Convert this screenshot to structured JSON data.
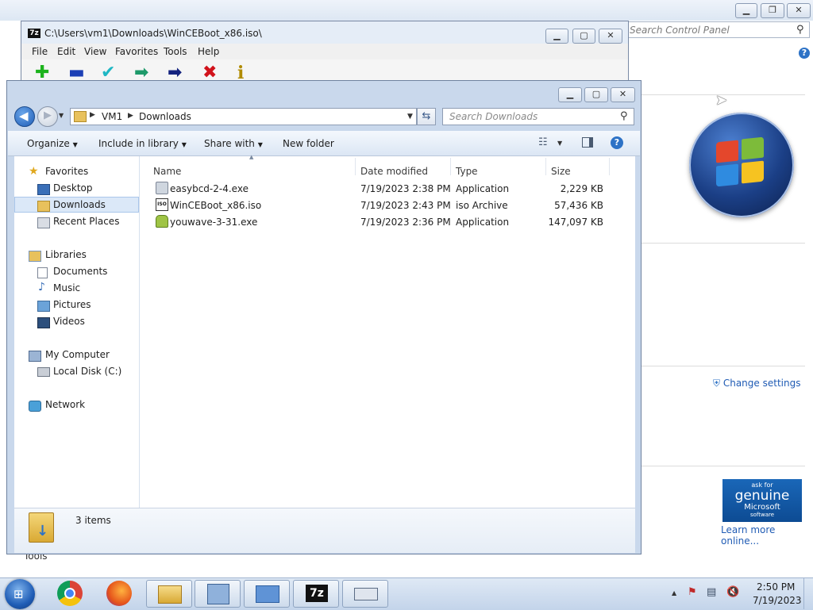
{
  "control_panel": {
    "search_placeholder": "Search Control Panel",
    "change_settings": "Change settings",
    "genuine": {
      "line1": "ask for",
      "line2": "genuine",
      "line3": "Microsoft",
      "line4": "software"
    },
    "learn_more": "Learn more online...",
    "tools_label": "Tools"
  },
  "sevenzip": {
    "title": "C:\\Users\\vm1\\Downloads\\WinCEBoot_x86.iso\\",
    "logo": "7z",
    "menu": [
      "File",
      "Edit",
      "View",
      "Favorites",
      "Tools",
      "Help"
    ],
    "toolbar_icons": [
      "add-icon",
      "extract-icon",
      "test-icon",
      "copy-icon",
      "move-icon",
      "delete-icon",
      "info-icon"
    ]
  },
  "explorer": {
    "breadcrumb": [
      "VM1",
      "Downloads"
    ],
    "search_placeholder": "Search Downloads",
    "commands": [
      "Organize",
      "Include in library",
      "Share with",
      "New folder"
    ],
    "nav": {
      "favorites_header": "Favorites",
      "favorites": [
        "Desktop",
        "Downloads",
        "Recent Places"
      ],
      "libraries_header": "Libraries",
      "libraries": [
        "Documents",
        "Music",
        "Pictures",
        "Videos"
      ],
      "computer_header": "My Computer",
      "computer": [
        "Local Disk (C:)"
      ],
      "network_header": "Network"
    },
    "columns": [
      "Name",
      "Date modified",
      "Type",
      "Size"
    ],
    "files": [
      {
        "name": "easybcd-2-4.exe",
        "date": "7/19/2023 2:38 PM",
        "type": "Application",
        "size": "2,229 KB"
      },
      {
        "name": "WinCEBoot_x86.iso",
        "date": "7/19/2023 2:43 PM",
        "type": "iso Archive",
        "size": "57,436 KB"
      },
      {
        "name": "youwave-3-31.exe",
        "date": "7/19/2023 2:36 PM",
        "type": "Application",
        "size": "147,097 KB"
      }
    ],
    "status": "3 items"
  },
  "taskbar": {
    "apps": [
      "chrome-icon",
      "firefox-icon",
      "explorer-icon",
      "control-panel-icon",
      "remote-desktop-icon",
      "sevenzip-icon",
      "keyboard-icon"
    ],
    "sevenzip_label": "7z",
    "time": "2:50 PM",
    "date": "7/19/2023"
  }
}
